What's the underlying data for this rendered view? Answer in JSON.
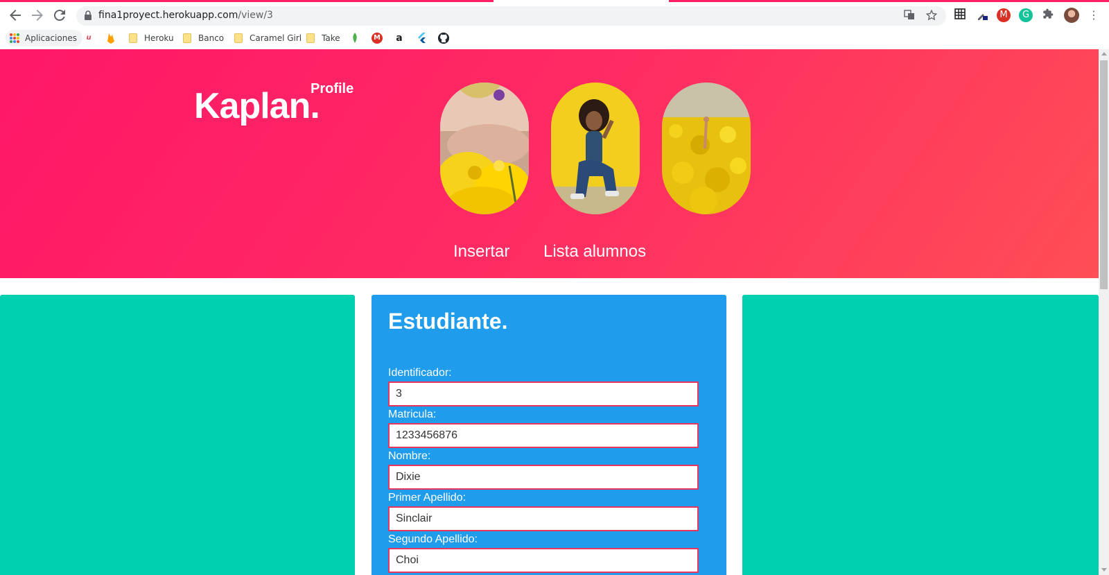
{
  "browser": {
    "url_host": "fina1proyect.herokuapp.com",
    "url_path": "/view/3",
    "bookmarks": {
      "apps": "Aplicaciones",
      "folders": [
        "Heroku",
        "Banco",
        "Caramel Girl",
        "Take"
      ]
    }
  },
  "hero": {
    "brand": "Kaplan.",
    "profile_label": "Profile",
    "nav": {
      "insert": "Insertar",
      "list": "Lista alumnos"
    }
  },
  "form": {
    "title": "Estudiante.",
    "fields": [
      {
        "label": "Identificador:",
        "value": "3"
      },
      {
        "label": "Matricula:",
        "value": "1233456876"
      },
      {
        "label": "Nombre:",
        "value": "Dixie"
      },
      {
        "label": "Primer Apellido:",
        "value": "Sinclair"
      },
      {
        "label": "Segundo Apellido:",
        "value": "Choi"
      }
    ]
  },
  "colors": {
    "hero_start": "#ff1768",
    "hero_end": "#ff4e55",
    "side_cards": "#00cfb0",
    "form_card": "#1f9cec",
    "input_border": "#e8365f"
  }
}
